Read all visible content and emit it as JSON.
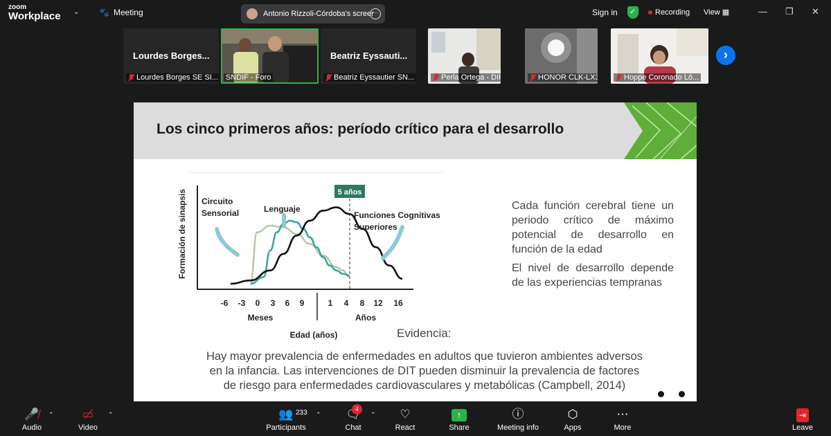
{
  "app": {
    "logo_top": "zoom",
    "logo_bottom": "Workplace",
    "meeting_label": "Meeting",
    "share_banner": "Antonio Rizzoli-Córdoba's screen",
    "sign_in": "Sign in",
    "recording": "Recording",
    "view": "View"
  },
  "participants_strip": [
    {
      "big_name": "Lourdes  Borges...",
      "caption": "Lourdes Borges SE SI...",
      "muted": true,
      "video": false
    },
    {
      "big_name": "",
      "caption": "SNDIF - Foro",
      "muted": false,
      "video": true,
      "active": true
    },
    {
      "big_name": "Beatriz  Eyssauti...",
      "caption": "Beatriz Eyssautier SN...",
      "muted": true,
      "video": false
    },
    {
      "big_name": "",
      "caption": "Perla Ortega - DIF Baj...",
      "muted": true,
      "video": true
    },
    {
      "big_name": "",
      "caption": "HONOR CLK-LX3",
      "muted": true,
      "video": true
    },
    {
      "big_name": "",
      "caption": "Hoppe Coronado Ló...",
      "muted": true,
      "video": true
    }
  ],
  "slide": {
    "title": "Los cinco primeros años: período crítico para el desarrollo",
    "paragraph1": "Cada función cerebral tiene un periodo crítico de máximo potencial de desarrollo en función de la edad",
    "paragraph2": "El nivel de desarrollo depende de las experiencias tempranas",
    "evidence_label": "Evidencia:",
    "evidence_text": "Hay mayor prevalencia de enfermedades en adultos que tuvieron ambientes adversos en la infancia. Las intervenciones de DIT pueden disminuir la prevalencia de factores de riesgo para  enfermedades cardiovasculares y metabólicas (Campbell, 2014)"
  },
  "chart_data": {
    "type": "line",
    "ylabel": "Formación de sinapsis",
    "xlabel": "Edad (años)",
    "x_ticks": [
      "-6",
      "-3",
      "0",
      "3",
      "6",
      "9",
      "1",
      "4",
      "8",
      "12",
      "16"
    ],
    "x_group_labels": [
      "Meses",
      "Años"
    ],
    "marker_label": "5 años",
    "series": [
      {
        "name": "Circuito Sensorial",
        "color": "#b7c9a6",
        "x": [
          -3,
          -2,
          0,
          2,
          4,
          6,
          8,
          10,
          11,
          12
        ],
        "y": [
          0.0,
          0.62,
          0.7,
          0.68,
          0.6,
          0.48,
          0.34,
          0.2,
          0.16,
          0.08
        ]
      },
      {
        "name": "Lenguaje",
        "color": "#3aa6a0",
        "x": [
          -3,
          -1,
          0,
          1,
          2,
          3,
          4,
          5,
          6,
          7,
          8,
          9,
          10,
          11,
          12
        ],
        "y": [
          0.0,
          0.08,
          0.4,
          0.62,
          0.72,
          0.76,
          0.74,
          0.66,
          0.56,
          0.44,
          0.32,
          0.22,
          0.16,
          0.12,
          0.1
        ]
      },
      {
        "name": "Funciones Cognitivas Superiores",
        "color": "#111111",
        "x": [
          -6,
          -3,
          0,
          2,
          4,
          6,
          8,
          10,
          12,
          14,
          16,
          18,
          20
        ],
        "y": [
          0.0,
          0.04,
          0.16,
          0.36,
          0.58,
          0.76,
          0.88,
          0.92,
          0.84,
          0.66,
          0.44,
          0.22,
          0.06
        ]
      }
    ]
  },
  "toolbar": {
    "audio": "Audio",
    "video": "Video",
    "participants": "Participants",
    "participants_count": "233",
    "chat": "Chat",
    "chat_badge": "4",
    "react": "React",
    "share": "Share",
    "meeting_info": "Meeting info",
    "apps": "Apps",
    "more": "More",
    "leave": "Leave"
  }
}
